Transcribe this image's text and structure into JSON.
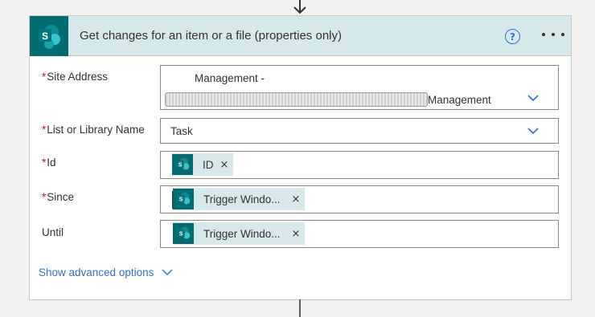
{
  "card": {
    "title": "Get changes for an item or a file (properties only)"
  },
  "fields": {
    "site_address": {
      "label": "Site Address",
      "line1": "Management -",
      "line2": "Management"
    },
    "list_name": {
      "label": "List or Library Name",
      "value": "Task"
    },
    "id": {
      "label": "Id",
      "token": "ID"
    },
    "since": {
      "label": "Since",
      "token": "Trigger Windo..."
    },
    "until": {
      "label": "Until",
      "token": "Trigger Windo..."
    }
  },
  "required_marker": "*",
  "token_close": "×",
  "advanced_options_label": "Show advanced options",
  "help_symbol": "?",
  "colors": {
    "header_bg": "#d7e8ea",
    "sharepoint_teal": "#036c70",
    "link_blue": "#2f6fd0",
    "required_red": "#a4262c"
  },
  "icons": [
    "arrow-down-icon",
    "sharepoint-icon",
    "help-icon",
    "more-options-icon",
    "chevron-down-icon",
    "close-icon"
  ]
}
